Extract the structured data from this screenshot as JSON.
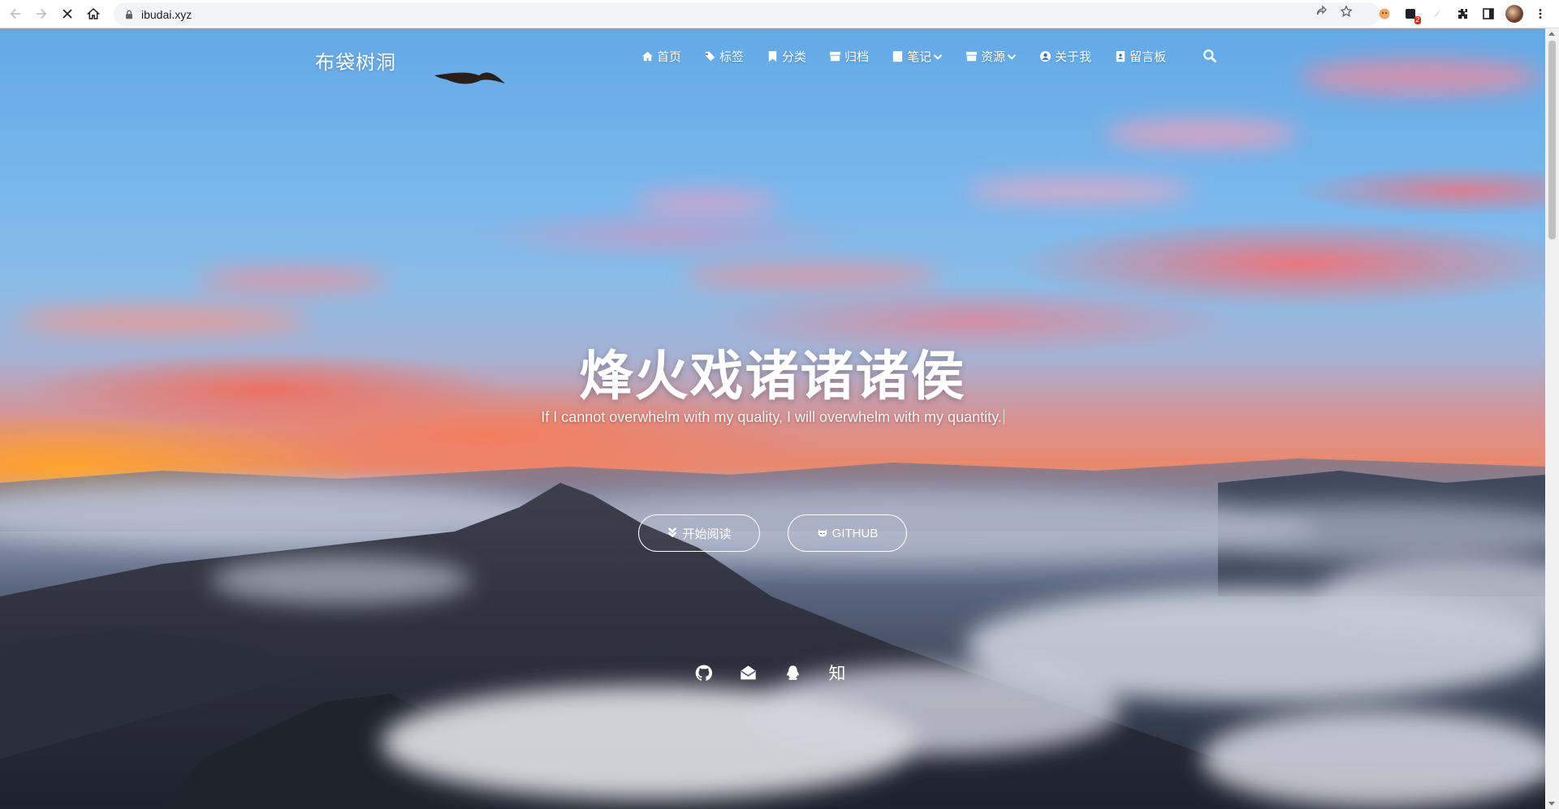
{
  "browser": {
    "url": "ibudai.xyz",
    "extension_badge": "2"
  },
  "site": {
    "brand": "布袋树洞",
    "menu": [
      {
        "label": "首页",
        "icon": "home-icon"
      },
      {
        "label": "标签",
        "icon": "tags-icon"
      },
      {
        "label": "分类",
        "icon": "bookmark-icon"
      },
      {
        "label": "归档",
        "icon": "archive-icon"
      },
      {
        "label": "笔记",
        "icon": "book-icon",
        "dropdown": true
      },
      {
        "label": "资源",
        "icon": "archive-icon",
        "dropdown": true
      },
      {
        "label": "关于我",
        "icon": "user-circle-icon"
      },
      {
        "label": "留言板",
        "icon": "address-book-icon"
      }
    ]
  },
  "hero": {
    "title": "烽火戏诸诸诸侯",
    "subtitle": "If I cannot overwhelm with my quality, I will overwhelm with my quantity.",
    "read_button": "开始阅读",
    "github_button": "GITHUB",
    "social": [
      {
        "name": "github-icon"
      },
      {
        "name": "email-icon"
      },
      {
        "name": "qq-icon"
      },
      {
        "name": "zhihu-icon",
        "glyph": "知"
      }
    ]
  }
}
